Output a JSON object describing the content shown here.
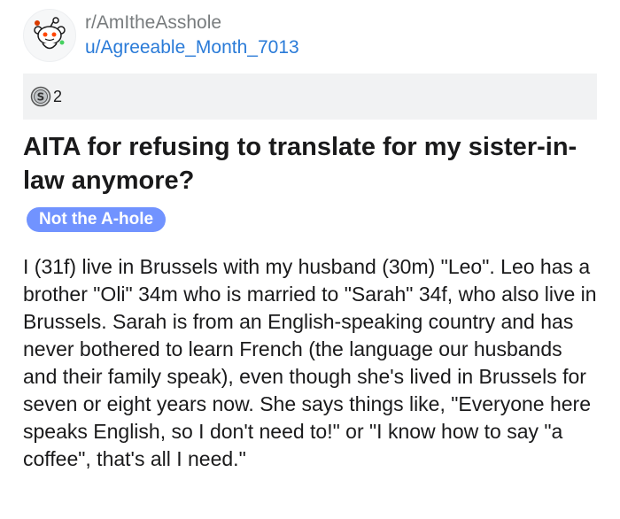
{
  "post": {
    "subreddit": "r/AmItheAsshole",
    "author": "u/Agreeable_Month_7013",
    "award_count": "2",
    "title": "AITA for refusing to translate for my sister-in-law anymore?",
    "flair": "Not the A-hole",
    "body": "I (31f) live in Brussels with my husband (30m) \"Leo\". Leo has a brother \"Oli\" 34m who is married to \"Sarah\" 34f, who also live in Brussels. Sarah is from an English-speaking country and has never bothered to learn French (the language our husbands and their family speak), even though she's lived in Brussels for seven or eight years now. She says things like, \"Everyone here speaks English, so I don't need to!\" or \"I know how to say \"a coffee\", that's all I need.\""
  },
  "icons": {
    "avatar": "snoo-avatar-icon",
    "award": "silver-award-icon"
  },
  "colors": {
    "flair_bg": "#7193ff",
    "username": "#2a7bd8",
    "subreddit": "#787c7e",
    "award_bar_bg": "#f1f2f3"
  }
}
